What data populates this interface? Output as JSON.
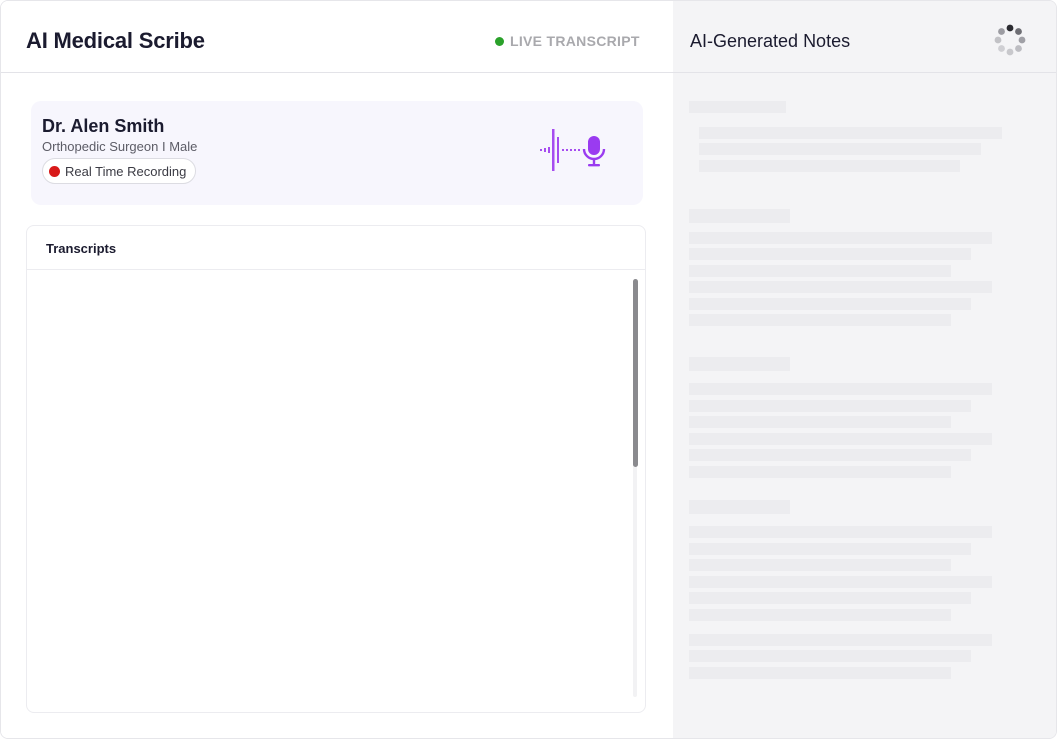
{
  "header": {
    "app_title": "AI Medical Scribe",
    "live_label": "LIVE TRANSCRIPT",
    "notes_title": "AI-Generated Notes"
  },
  "doctor": {
    "name": "Dr. Alen Smith",
    "specialty": "Orthopedic Surgeon I Male",
    "recording_label": "Real Time Recording"
  },
  "transcripts": {
    "title": "Transcripts"
  },
  "icons": {
    "live": "status-dot-icon",
    "recording": "record-dot-icon",
    "microphone": "microphone-icon",
    "waveform": "audio-waveform-icon",
    "loading": "loading-spinner-icon"
  },
  "colors": {
    "accent_purple": "#9a3bf0",
    "live_green": "#2aa12a",
    "record_red": "#d81919",
    "notes_background": "#f4f4f6",
    "skeleton": "#ececef"
  }
}
